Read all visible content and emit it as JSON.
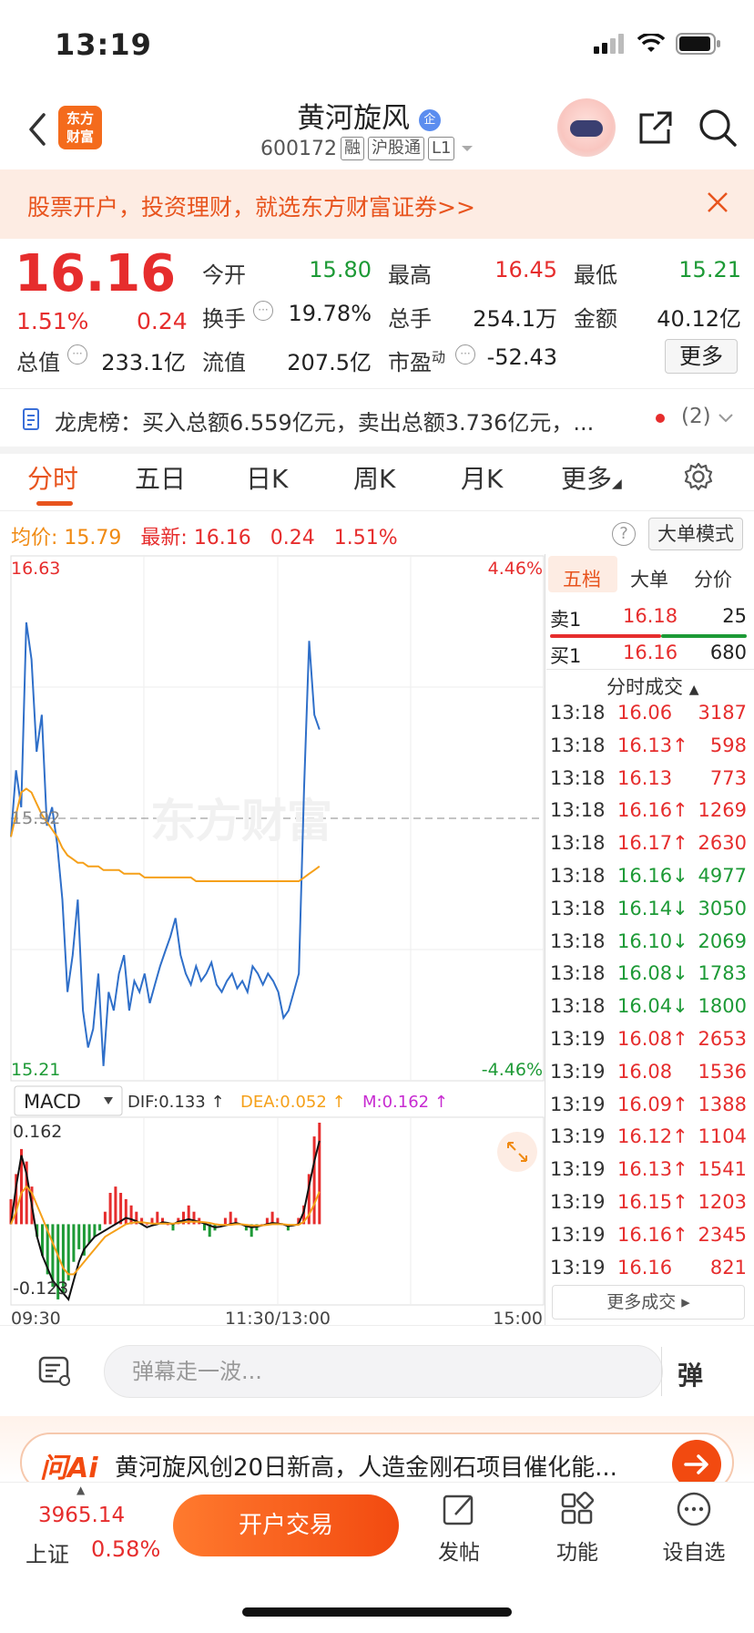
{
  "status": {
    "time": "13:19"
  },
  "header": {
    "logo_text_1": "东方",
    "logo_text_2": "财富",
    "stock_name": "黄河旋风",
    "name_badge": "企",
    "code": "600172",
    "tags": [
      "融",
      "沪股通",
      "L1"
    ]
  },
  "banner": {
    "text": "股票开户，投资理财，就选东方财富证券>>"
  },
  "quote": {
    "price": "16.16",
    "pct": "1.51%",
    "chg": "0.24",
    "rows": [
      [
        {
          "label": "今开",
          "value": "15.80",
          "color": "green"
        },
        {
          "label": "最高",
          "value": "16.45",
          "color": "red"
        },
        {
          "label": "最低",
          "value": "15.21",
          "color": "green"
        }
      ],
      [
        {
          "label": "换手",
          "value": "19.78%",
          "color": "black"
        },
        {
          "label": "总手",
          "value": "254.1万",
          "color": "black"
        },
        {
          "label": "金额",
          "value": "40.12亿",
          "color": "black"
        }
      ]
    ],
    "total_value_label": "总值",
    "total_value": "233.1亿",
    "float_value_label": "流值",
    "float_value": "207.5亿",
    "pe_label": "市盈",
    "pe_sup": "动",
    "pe_value": "-52.43",
    "more_label": "更多"
  },
  "dragon_tiger": {
    "text": "龙虎榜：买入总额6.559亿元，卖出总额3.736亿元，...",
    "count": "(2)"
  },
  "tabs": [
    "分时",
    "五日",
    "日K",
    "周K",
    "月K",
    "更多"
  ],
  "info_line": {
    "avg_label": "均价:",
    "avg_value": "15.79",
    "latest_label": "最新:",
    "latest_value": "16.16",
    "chg": "0.24",
    "pct": "1.51%",
    "big_order_mode": "大单模式"
  },
  "chart_labels": {
    "top_price": "16.63",
    "top_pct": "4.46%",
    "mid_price": "15.92",
    "bottom_price": "15.21",
    "bottom_pct": "-4.46%",
    "watermark": "东方财富",
    "macd_select": "MACD",
    "dif": "DIF:0.133 ↑",
    "dea": "DEA:0.052 ↑",
    "m": "M:0.162 ↑",
    "macd_top": "0.162",
    "macd_bottom": "-0.123",
    "time_start": "09:30",
    "time_mid": "11:30/13:00",
    "time_end": "15:00"
  },
  "chart_data": {
    "type": "line",
    "ylim": [
      15.21,
      16.63
    ],
    "y_pct_range": [
      "-4.46%",
      "4.46%"
    ],
    "reference_price": 15.92,
    "x_ticks": [
      "09:30",
      "11:30/13:00",
      "15:00"
    ],
    "series": [
      {
        "name": "最新",
        "color": "#2f6fc9",
        "values": [
          15.87,
          16.05,
          15.95,
          16.45,
          16.35,
          16.1,
          16.2,
          15.9,
          15.95,
          15.85,
          15.7,
          15.45,
          15.55,
          15.7,
          15.4,
          15.3,
          15.35,
          15.5,
          15.25,
          15.45,
          15.4,
          15.5,
          15.55,
          15.4,
          15.48,
          15.45,
          15.5,
          15.42,
          15.47,
          15.52,
          15.56,
          15.6,
          15.65,
          15.55,
          15.5,
          15.47,
          15.52,
          15.48,
          15.5,
          15.53,
          15.47,
          15.45,
          15.48,
          15.5,
          15.46,
          15.48,
          15.45,
          15.52,
          15.5,
          15.47,
          15.5,
          15.48,
          15.45,
          15.38,
          15.4,
          15.45,
          15.5,
          16.0,
          16.4,
          16.2,
          16.16
        ]
      },
      {
        "name": "均价",
        "color": "#f5a01a",
        "values": [
          15.87,
          15.93,
          15.99,
          16.0,
          15.99,
          15.96,
          15.93,
          15.91,
          15.89,
          15.87,
          15.84,
          15.82,
          15.81,
          15.8,
          15.8,
          15.79,
          15.79,
          15.79,
          15.78,
          15.78,
          15.78,
          15.78,
          15.77,
          15.77,
          15.77,
          15.77,
          15.76,
          15.76,
          15.76,
          15.76,
          15.76,
          15.76,
          15.76,
          15.76,
          15.76,
          15.76,
          15.75,
          15.75,
          15.75,
          15.75,
          15.75,
          15.75,
          15.75,
          15.75,
          15.75,
          15.75,
          15.75,
          15.75,
          15.75,
          15.75,
          15.75,
          15.75,
          15.75,
          15.75,
          15.75,
          15.75,
          15.75,
          15.76,
          15.77,
          15.78,
          15.79
        ]
      }
    ]
  },
  "macd_data": {
    "ylim": [
      -0.123,
      0.162
    ],
    "hist": [
      0.04,
      0.08,
      0.12,
      0.1,
      0.06,
      -0.02,
      -0.05,
      -0.08,
      -0.1,
      -0.12,
      -0.11,
      -0.09,
      -0.06,
      -0.04,
      -0.05,
      -0.03,
      -0.02,
      -0.01,
      0.02,
      0.05,
      0.06,
      0.05,
      0.04,
      0.03,
      0.02,
      0.01,
      0.0,
      0.01,
      0.02,
      0.01,
      0.0,
      -0.01,
      0.01,
      0.02,
      0.03,
      0.02,
      0.01,
      -0.01,
      -0.02,
      -0.01,
      0.0,
      0.01,
      0.02,
      0.01,
      0.0,
      -0.01,
      -0.02,
      -0.01,
      0.0,
      0.01,
      0.02,
      0.01,
      0.0,
      -0.01,
      0.0,
      0.01,
      0.03,
      0.08,
      0.14,
      0.162
    ],
    "dif": [
      0.0,
      0.06,
      0.11,
      0.08,
      0.03,
      -0.02,
      -0.05,
      -0.07,
      -0.09,
      -0.1,
      -0.11,
      -0.12,
      -0.09,
      -0.06,
      -0.04,
      -0.03,
      -0.02,
      -0.015,
      -0.01,
      -0.005,
      0.0,
      0.005,
      0.01,
      0.008,
      0.005,
      0.0,
      -0.005,
      -0.002,
      0.0,
      0.003,
      0.002,
      0.0,
      0.004,
      0.006,
      0.008,
      0.006,
      0.004,
      0.001,
      -0.002,
      -0.005,
      -0.004,
      -0.002,
      0.0,
      0.002,
      0.0,
      -0.003,
      -0.005,
      -0.004,
      -0.002,
      0.0,
      0.002,
      0.001,
      0.0,
      -0.003,
      -0.002,
      0.0,
      0.02,
      0.06,
      0.1,
      0.133
    ],
    "dea": [
      0.0,
      0.02,
      0.05,
      0.06,
      0.05,
      0.03,
      0.01,
      -0.01,
      -0.03,
      -0.05,
      -0.07,
      -0.08,
      -0.08,
      -0.07,
      -0.06,
      -0.05,
      -0.04,
      -0.03,
      -0.02,
      -0.015,
      -0.01,
      -0.005,
      0.0,
      0.002,
      0.003,
      0.003,
      0.002,
      0.001,
      0.001,
      0.001,
      0.001,
      0.001,
      0.002,
      0.003,
      0.004,
      0.004,
      0.004,
      0.003,
      0.002,
      0.0,
      -0.001,
      -0.001,
      -0.001,
      0.0,
      0.0,
      -0.001,
      -0.002,
      -0.002,
      -0.002,
      -0.001,
      0.0,
      0.0,
      0.0,
      -0.001,
      -0.001,
      -0.001,
      0.004,
      0.015,
      0.032,
      0.052
    ]
  },
  "right_panel": {
    "tabs": [
      "五档",
      "大单",
      "分价"
    ],
    "sell1": {
      "label": "卖1",
      "price": "16.18",
      "vol": "25"
    },
    "buy1": {
      "label": "买1",
      "price": "16.16",
      "vol": "680"
    },
    "ticks_header": "分时成交",
    "ticks": [
      {
        "t": "13:18",
        "p": "16.06",
        "a": "",
        "v": "3187",
        "c": "red"
      },
      {
        "t": "13:18",
        "p": "16.13",
        "a": "↑",
        "v": "598",
        "c": "red"
      },
      {
        "t": "13:18",
        "p": "16.13",
        "a": "",
        "v": "773",
        "c": "red"
      },
      {
        "t": "13:18",
        "p": "16.16",
        "a": "↑",
        "v": "1269",
        "c": "red"
      },
      {
        "t": "13:18",
        "p": "16.17",
        "a": "↑",
        "v": "2630",
        "c": "red"
      },
      {
        "t": "13:18",
        "p": "16.16",
        "a": "↓",
        "v": "4977",
        "c": "green"
      },
      {
        "t": "13:18",
        "p": "16.14",
        "a": "↓",
        "v": "3050",
        "c": "green"
      },
      {
        "t": "13:18",
        "p": "16.10",
        "a": "↓",
        "v": "2069",
        "c": "green"
      },
      {
        "t": "13:18",
        "p": "16.08",
        "a": "↓",
        "v": "1783",
        "c": "green"
      },
      {
        "t": "13:18",
        "p": "16.04",
        "a": "↓",
        "v": "1800",
        "c": "green"
      },
      {
        "t": "13:19",
        "p": "16.08",
        "a": "↑",
        "v": "2653",
        "c": "red"
      },
      {
        "t": "13:19",
        "p": "16.08",
        "a": "",
        "v": "1536",
        "c": "red"
      },
      {
        "t": "13:19",
        "p": "16.09",
        "a": "↑",
        "v": "1388",
        "c": "red"
      },
      {
        "t": "13:19",
        "p": "16.12",
        "a": "↑",
        "v": "1104",
        "c": "red"
      },
      {
        "t": "13:19",
        "p": "16.13",
        "a": "↑",
        "v": "1541",
        "c": "red"
      },
      {
        "t": "13:19",
        "p": "16.15",
        "a": "↑",
        "v": "1203",
        "c": "red"
      },
      {
        "t": "13:19",
        "p": "16.16",
        "a": "↑",
        "v": "2345",
        "c": "red"
      },
      {
        "t": "13:19",
        "p": "16.16",
        "a": "",
        "v": "821",
        "c": "red"
      }
    ],
    "more_ticks": "更多成交 ▸"
  },
  "danmu": {
    "placeholder": "弹幕走一波...",
    "btn": "弹"
  },
  "ai_banner": {
    "logo": "问Ai",
    "text": "黄河旋风创20日新高，人造金刚石项目催化能..."
  },
  "bottom_bar": {
    "index_value": "3965.14",
    "index_name": "上证",
    "index_pct": "0.58%",
    "open_trade": "开户交易",
    "items": [
      "发帖",
      "功能",
      "设自选"
    ]
  }
}
